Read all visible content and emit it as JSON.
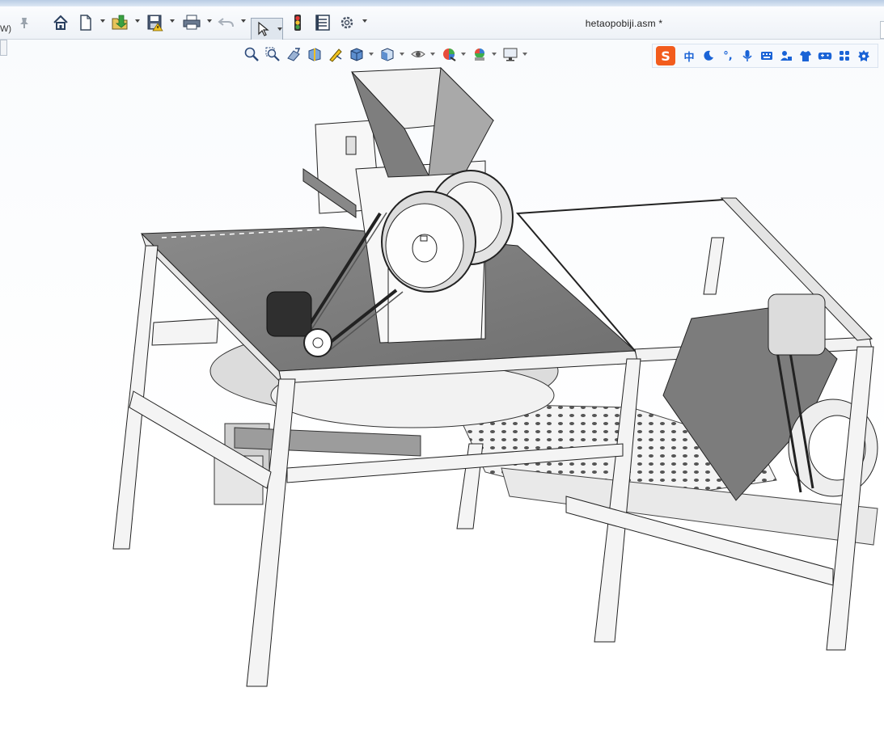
{
  "window": {
    "title": "hetaopobiji.asm *",
    "left_partial_text": "W)"
  },
  "toolbar": {
    "items": [
      {
        "name": "pin",
        "icon": "pin-icon"
      },
      {
        "name": "home",
        "icon": "home-icon"
      },
      {
        "name": "new",
        "icon": "new-document-icon"
      },
      {
        "name": "open",
        "icon": "open-folder-icon"
      },
      {
        "name": "save",
        "icon": "save-icon"
      },
      {
        "name": "print",
        "icon": "print-icon"
      },
      {
        "name": "undo",
        "icon": "undo-icon"
      },
      {
        "name": "select",
        "icon": "cursor-icon"
      },
      {
        "name": "rebuild",
        "icon": "traffic-light-icon"
      },
      {
        "name": "file-properties",
        "icon": "properties-icon"
      },
      {
        "name": "options",
        "icon": "gear-icon"
      }
    ]
  },
  "heads_up_toolbar": {
    "items": [
      "zoom-to-fit-icon",
      "zoom-to-area-icon",
      "previous-view-icon",
      "section-view-icon",
      "dynamic-annotation-icon",
      "view-orientation-icon",
      "display-style-icon",
      "hide-show-items-icon",
      "edit-appearance-icon",
      "apply-scene-icon",
      "view-settings-icon"
    ]
  },
  "ime_bar": {
    "logo": "S",
    "mode": "中",
    "items": [
      "moon-icon",
      "punctuation-icon",
      "microphone-icon",
      "keyboard-icon",
      "user-icon",
      "shirt-icon",
      "gamepad-icon",
      "apps-grid-icon",
      "settings-icon"
    ],
    "punct_label": "°,"
  },
  "colors": {
    "accent": "#1a63d6",
    "ime_logo": "#f25c1d"
  }
}
